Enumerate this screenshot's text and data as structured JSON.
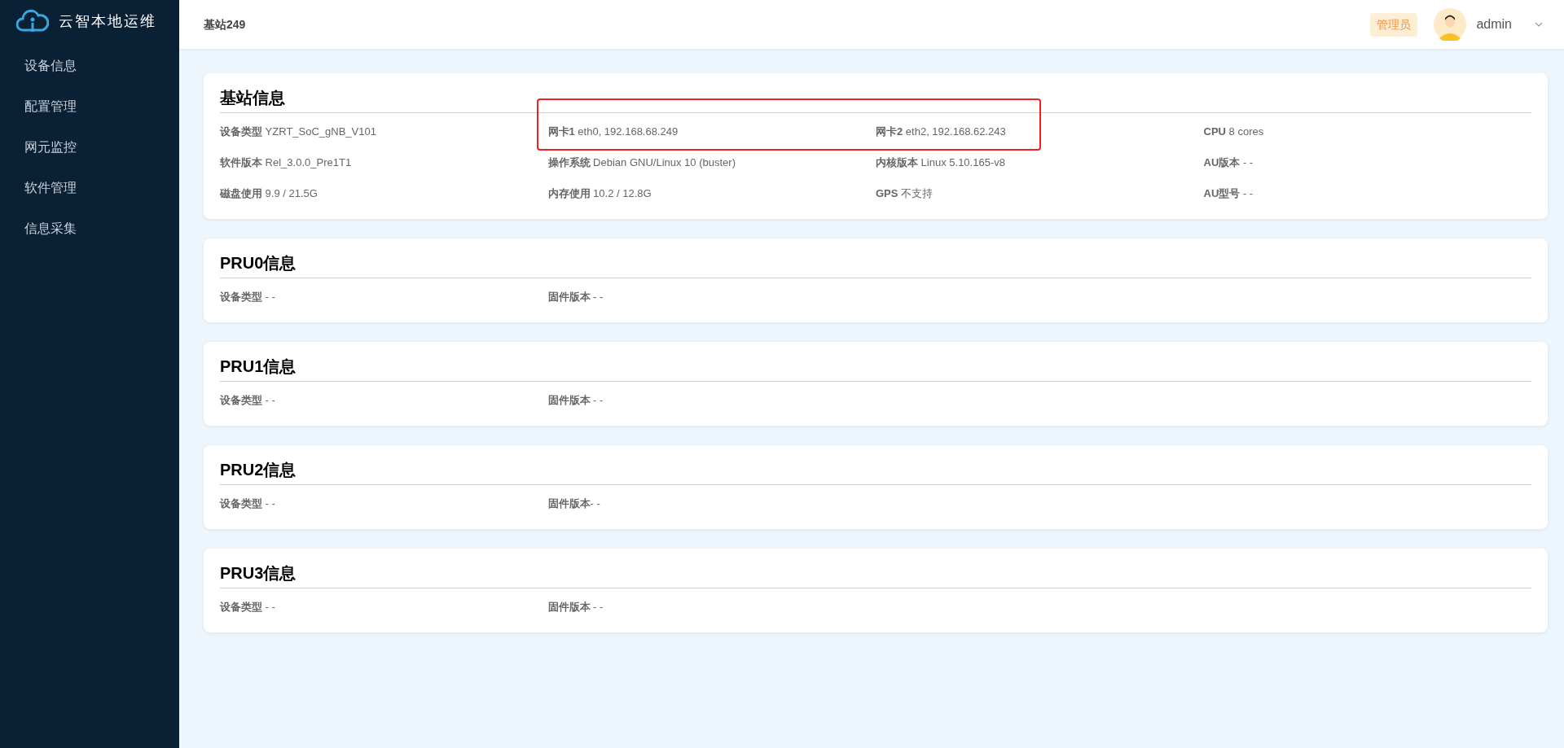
{
  "app": {
    "title": "云智本地运维"
  },
  "sidebar": {
    "items": [
      {
        "label": "设备信息",
        "selected": false
      },
      {
        "label": "配置管理",
        "selected": false
      },
      {
        "label": "网元监控",
        "selected": false
      },
      {
        "label": "软件管理",
        "selected": false
      },
      {
        "label": "信息采集",
        "selected": false
      }
    ]
  },
  "header": {
    "title": "基站249",
    "role_badge": "管理员",
    "user": "admin"
  },
  "cards": [
    {
      "title": "基站信息",
      "rows": [
        [
          {
            "text": "**设备类型** YZRT_SoC_gNB_V101",
            "highlighted": false
          },
          {
            "text": "**网卡1** eth0, 192.168.68.249",
            "highlighted": true
          },
          {
            "text": "**网卡2** eth2, 192.168.62.243",
            "highlighted": true
          },
          {
            "text": "**CPU** 8 cores",
            "highlighted": false
          }
        ],
        [
          {
            "text": "**软件版本** Rel_3.0.0_Pre1T1",
            "highlighted": false
          },
          {
            "text": "**操作系统** Debian GNU/Linux 10 (buster)",
            "highlighted": false
          },
          {
            "text": "**内核版本** Linux 5.10.165-v8",
            "highlighted": false
          },
          {
            "text": "**AU版本** - -",
            "highlighted": false
          }
        ],
        [
          {
            "text": "**磁盘使用** 9.9 / 21.5G",
            "highlighted": false
          },
          {
            "text": "**内存使用** 10.2 / 12.8G",
            "highlighted": false
          },
          {
            "text": "**GPS** 不支持",
            "highlighted": false
          },
          {
            "text": "**AU型号** - -",
            "highlighted": false
          }
        ]
      ]
    },
    {
      "title": "PRU0信息",
      "rows": [
        [
          {
            "text": "**设备类型** - -",
            "highlighted": false
          },
          {
            "text": "**固件版本** - -",
            "highlighted": false
          }
        ]
      ]
    },
    {
      "title": "PRU1信息",
      "rows": [
        [
          {
            "text": "**设备类型** - -",
            "highlighted": false
          },
          {
            "text": "**固件版本** - -",
            "highlighted": false
          }
        ]
      ]
    },
    {
      "title": "PRU2信息",
      "rows": [
        [
          {
            "text": "**设备类型** - -",
            "highlighted": false
          },
          {
            "text": "**固件版本**- -",
            "highlighted": false
          }
        ]
      ]
    },
    {
      "title": "PRU3信息",
      "rows": [
        [
          {
            "text": "**设备类型** - -",
            "highlighted": false
          },
          {
            "text": "**固件版本** - -",
            "highlighted": false
          }
        ]
      ]
    }
  ]
}
